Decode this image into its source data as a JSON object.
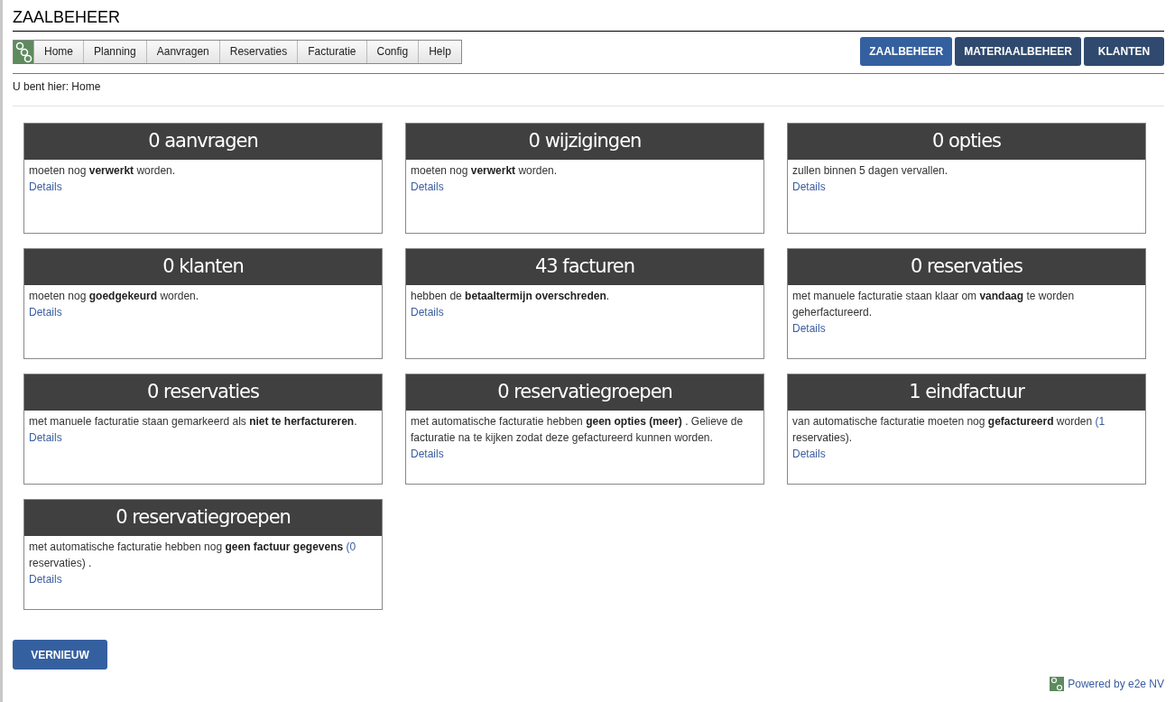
{
  "page_title": "ZAALBEHEER",
  "menu": [
    {
      "label": "Home"
    },
    {
      "label": "Planning"
    },
    {
      "label": "Aanvragen"
    },
    {
      "label": "Reservaties"
    },
    {
      "label": "Facturatie"
    },
    {
      "label": "Config"
    },
    {
      "label": "Help"
    }
  ],
  "modules": [
    {
      "label": "ZAALBEHEER",
      "selected": true
    },
    {
      "label": "MATERIAALBEHEER",
      "selected": false
    },
    {
      "label": "KLANTEN",
      "selected": false
    }
  ],
  "breadcrumb": "U bent hier: Home",
  "cards": [
    {
      "title": "0 aanvragen",
      "body": [
        {
          "kind": "plain",
          "text": "moeten nog "
        },
        {
          "kind": "bold",
          "text": "verwerkt"
        },
        {
          "kind": "plain",
          "text": " worden."
        }
      ],
      "link": "Details"
    },
    {
      "title": "0 wijzigingen",
      "body": [
        {
          "kind": "plain",
          "text": "moeten nog "
        },
        {
          "kind": "bold",
          "text": "verwerkt"
        },
        {
          "kind": "plain",
          "text": " worden."
        }
      ],
      "link": "Details"
    },
    {
      "title": "0 opties",
      "body": [
        {
          "kind": "plain",
          "text": "zullen binnen 5 dagen vervallen."
        }
      ],
      "link": "Details"
    },
    {
      "title": "0 klanten",
      "body": [
        {
          "kind": "plain",
          "text": "moeten nog "
        },
        {
          "kind": "bold",
          "text": "goedgekeurd"
        },
        {
          "kind": "plain",
          "text": " worden."
        }
      ],
      "link": "Details"
    },
    {
      "title": "43 facturen",
      "body": [
        {
          "kind": "plain",
          "text": "hebben de "
        },
        {
          "kind": "bold",
          "text": "betaaltermijn overschreden"
        },
        {
          "kind": "plain",
          "text": "."
        }
      ],
      "link": "Details"
    },
    {
      "title": "0 reservaties",
      "body": [
        {
          "kind": "plain",
          "text": "met manuele facturatie staan klaar om "
        },
        {
          "kind": "bold",
          "text": "vandaag"
        },
        {
          "kind": "plain",
          "text": " te worden geherfactureerd."
        }
      ],
      "link": "Details"
    },
    {
      "title": "0 reservaties",
      "body": [
        {
          "kind": "plain",
          "text": "met manuele facturatie staan gemarkeerd als "
        },
        {
          "kind": "bold",
          "text": "niet te herfactureren"
        },
        {
          "kind": "plain",
          "text": "."
        }
      ],
      "link": "Details"
    },
    {
      "title": "0 reservatiegroepen",
      "body": [
        {
          "kind": "plain",
          "text": "met automatische facturatie hebben "
        },
        {
          "kind": "bold",
          "text": "geen opties (meer)"
        },
        {
          "kind": "plain",
          "text": " . Gelieve de facturatie na te kijken zodat deze gefactureerd kunnen worden."
        }
      ],
      "link": "Details"
    },
    {
      "title": "1 eindfactuur",
      "body": [
        {
          "kind": "plain",
          "text": "van automatische facturatie moeten nog "
        },
        {
          "kind": "bold",
          "text": "gefactureerd"
        },
        {
          "kind": "plain",
          "text": " worden"
        },
        {
          "kind": "link",
          "text": "(1"
        },
        {
          "kind": "plain",
          "text": " reservaties)."
        }
      ],
      "link": "Details"
    },
    {
      "title": "0 reservatiegroepen",
      "body": [
        {
          "kind": "plain",
          "text": "met automatische facturatie hebben nog "
        },
        {
          "kind": "bold",
          "text": "geen factuur gegevens"
        },
        {
          "kind": "link",
          "text": "(0"
        },
        {
          "kind": "plain",
          "text": " reservaties) ."
        }
      ],
      "link": "Details"
    }
  ],
  "refresh_button": "VERNIEUW",
  "footer": "Powered by e2e NV"
}
